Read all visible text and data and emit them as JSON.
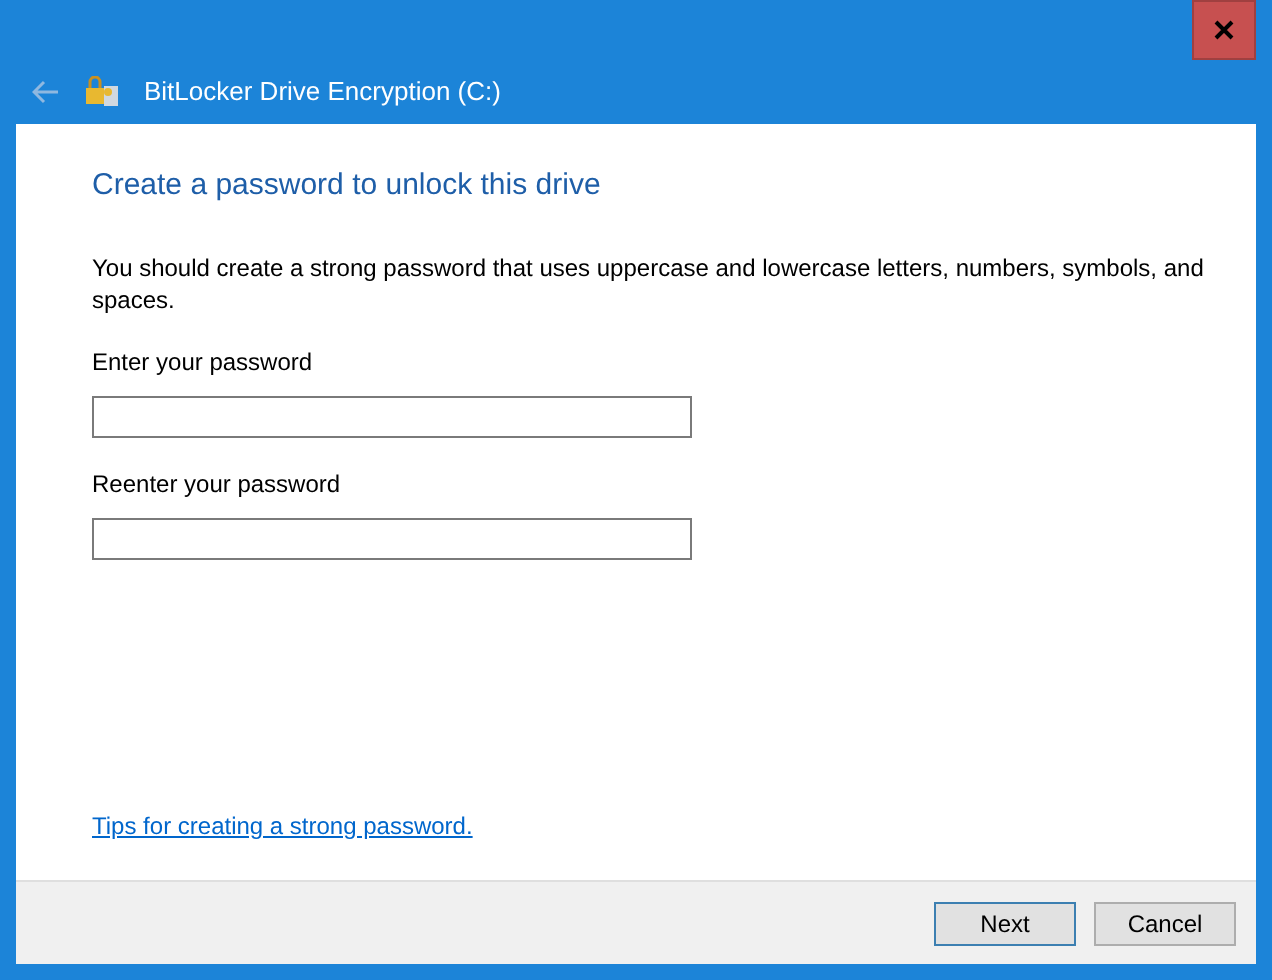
{
  "window": {
    "title": "BitLocker Drive Encryption (C:)"
  },
  "heading": "Create a password to unlock this drive",
  "description": "You should create a strong password that uses uppercase and lowercase letters, numbers, symbols, and spaces.",
  "fields": [
    {
      "label": "Enter your password"
    },
    {
      "label": "Reenter your password"
    }
  ],
  "link": "Tips for creating a strong password.",
  "buttons": [
    {
      "label": "Next",
      "default": true
    },
    {
      "label": "Cancel",
      "default": false
    }
  ]
}
